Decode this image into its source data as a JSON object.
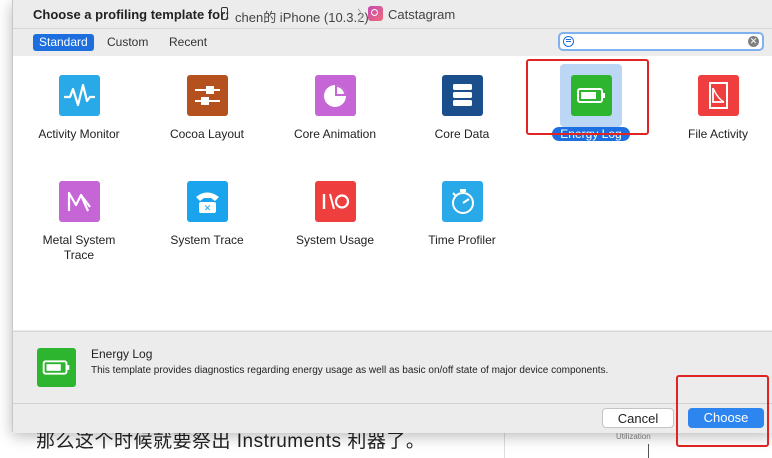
{
  "background": {
    "text": "那么这个时候就要祭出 Instruments 利器了。",
    "util_label": "Utilization"
  },
  "titlebar": {
    "label": "Choose a profiling template for:",
    "device_icon": "iphone-icon",
    "device": "chen的 iPhone (10.3.2)",
    "separator": "〉",
    "app_icon": "catstagram-app-icon",
    "app": "Catstagram"
  },
  "tabs": [
    {
      "label": "Standard",
      "active": true
    },
    {
      "label": "Custom",
      "active": false
    },
    {
      "label": "Recent",
      "active": false
    }
  ],
  "search": {
    "value": "",
    "placeholder": "",
    "filter_icon": "filter-icon",
    "clear_icon": "clear-icon"
  },
  "templates": [
    {
      "label": "Activity Monitor",
      "icon": "activity-monitor-icon",
      "color": "#2aa9e8"
    },
    {
      "label": "Cocoa Layout",
      "icon": "cocoa-layout-icon",
      "color": "#b5501f"
    },
    {
      "label": "Core Animation",
      "icon": "core-animation-icon",
      "color": "#c565d6"
    },
    {
      "label": "Core Data",
      "icon": "core-data-icon",
      "color": "#1a4f8c"
    },
    {
      "label": "Energy Log",
      "icon": "energy-log-icon",
      "color": "#2db52f",
      "selected": true
    },
    {
      "label": "File Activity",
      "icon": "file-activity-icon",
      "color": "#ef3e3e"
    },
    {
      "label": "Metal System Trace",
      "icon": "metal-system-trace-icon",
      "color": "#c565d6"
    },
    {
      "label": "System Trace",
      "icon": "system-trace-icon",
      "color": "#1aa4ee"
    },
    {
      "label": "System Usage",
      "icon": "system-usage-icon",
      "color": "#ef3e3e"
    },
    {
      "label": "Time Profiler",
      "icon": "time-profiler-icon",
      "color": "#2aa9e8"
    }
  ],
  "description": {
    "icon": "energy-log-icon",
    "title": "Energy Log",
    "text": "This template provides diagnostics regarding energy usage as well as basic on/off state of major device components."
  },
  "footer": {
    "cancel_label": "Cancel",
    "choose_label": "Choose"
  },
  "colors": {
    "accent": "#1d6fe0",
    "highlight": "#e02424"
  }
}
